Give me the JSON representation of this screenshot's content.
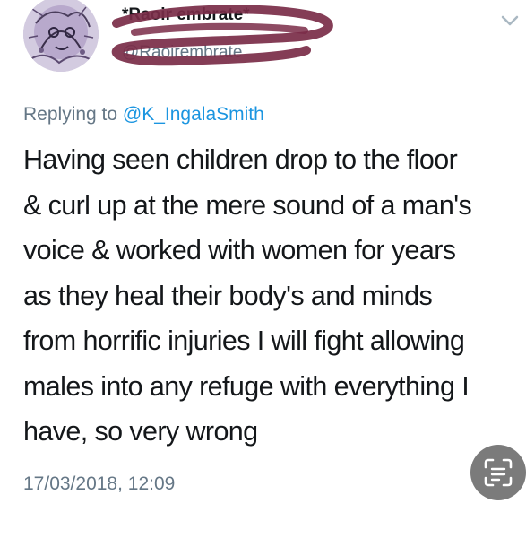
{
  "author": {
    "display_name": "*Raoir embrate*",
    "handle": "@Raoirembrate"
  },
  "reply_context": {
    "prefix": "Replying to ",
    "mention": "@K_IngalaSmith"
  },
  "tweet": {
    "lines": [
      "Having seen children drop to the floor",
      "& curl up at the mere sound of a man's",
      "voice & worked with women for years",
      "as they heal their body's and minds",
      "from horrific injuries I will fight allowing",
      "males into any refuge with everything I",
      "have, so very wrong"
    ],
    "timestamp": "17/03/2018, 12:09"
  },
  "icons": {
    "menu": "chevron-down-icon",
    "scan": "text-scan-icon"
  },
  "colors": {
    "mention": "#1b95e0",
    "secondary_text": "#657786",
    "redaction": "#7a2c48"
  }
}
